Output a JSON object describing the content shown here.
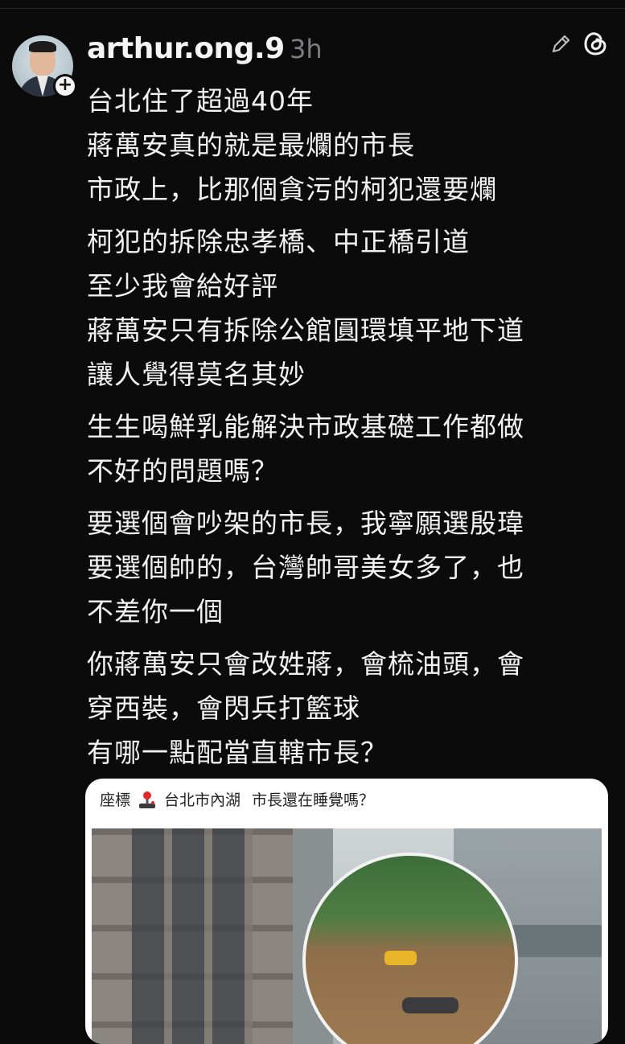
{
  "post": {
    "username": "arthur.ong.9",
    "time": "3h",
    "follow_symbol": "+",
    "paragraphs": [
      [
        "台北住了超過40年",
        "蔣萬安真的就是最爛的市長",
        "市政上，比那個貪污的柯犯還要爛"
      ],
      [
        "柯犯的拆除忠孝橋、中正橋引道",
        "至少我會給好評",
        "蔣萬安只有拆除公館圓環填平地下道",
        "讓人覺得莫名其妙"
      ],
      [
        "生生喝鮮乳能解決市政基礎工作都做",
        "不好的問題嗎？"
      ],
      [
        "要選個會吵架的市長，我寧願選殷瑋",
        "要選個帥的，台灣帥哥美女多了，也",
        "不差你一個"
      ],
      [
        "你蔣萬安只會改姓蔣，會梳油頭，會",
        "穿西裝，會閃兵打籃球",
        "有哪一點配當直轄市長？"
      ]
    ]
  },
  "media": {
    "caption_prefix": "座標",
    "caption_location": "台北市內湖",
    "caption_question": "市長還在睡覺嗎？"
  },
  "icons": [
    "edit-icon",
    "threads-logo-icon",
    "joystick-icon",
    "follow-plus-icon"
  ],
  "colors": {
    "background": "#0b0b0c",
    "text": "#f2f2f2",
    "muted": "#7d7d7f",
    "card": "#ffffff"
  }
}
